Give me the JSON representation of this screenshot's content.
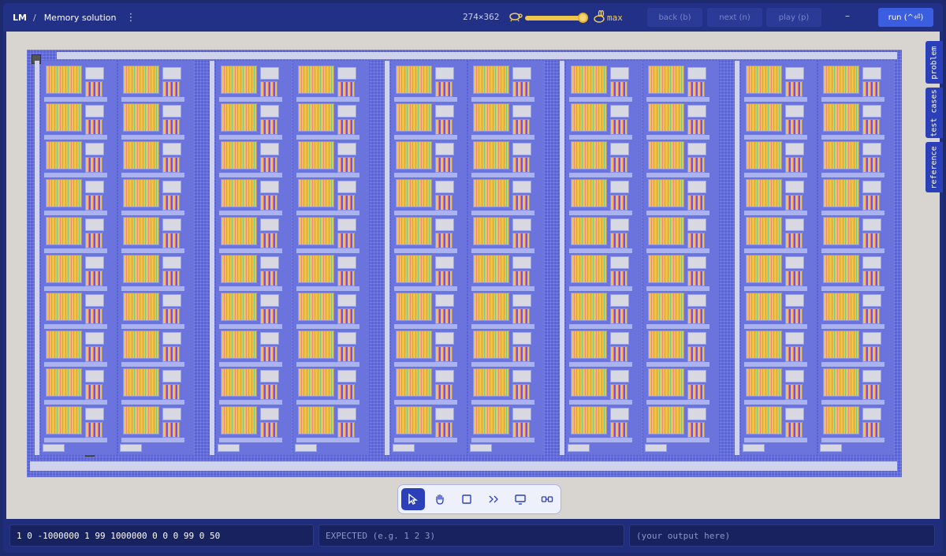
{
  "header": {
    "brand": "LM",
    "separator": "/",
    "title": "Memory solution",
    "dimensions": "274×362",
    "speed_label": "max",
    "buttons": {
      "back": "back (b)",
      "next": "next (n)",
      "play": "play (p)",
      "minus": "–",
      "run": "run (^⏎)"
    }
  },
  "side_tabs": [
    "problem",
    "test cases",
    "reference"
  ],
  "tools": [
    "pointer-icon",
    "hand-icon",
    "square-icon",
    "wire-icon",
    "monitor-icon",
    "link-icon"
  ],
  "io": {
    "input_value": "1 0 -1000000 1 99 1000000 0 0 0 99 0 50",
    "expected_placeholder": "EXPECTED (e.g. 1 2 3)",
    "output_placeholder": "(your output here)"
  },
  "colors": {
    "accent": "#3b5ee0",
    "board": "#5a64d6",
    "cell": "#f0c24a"
  }
}
